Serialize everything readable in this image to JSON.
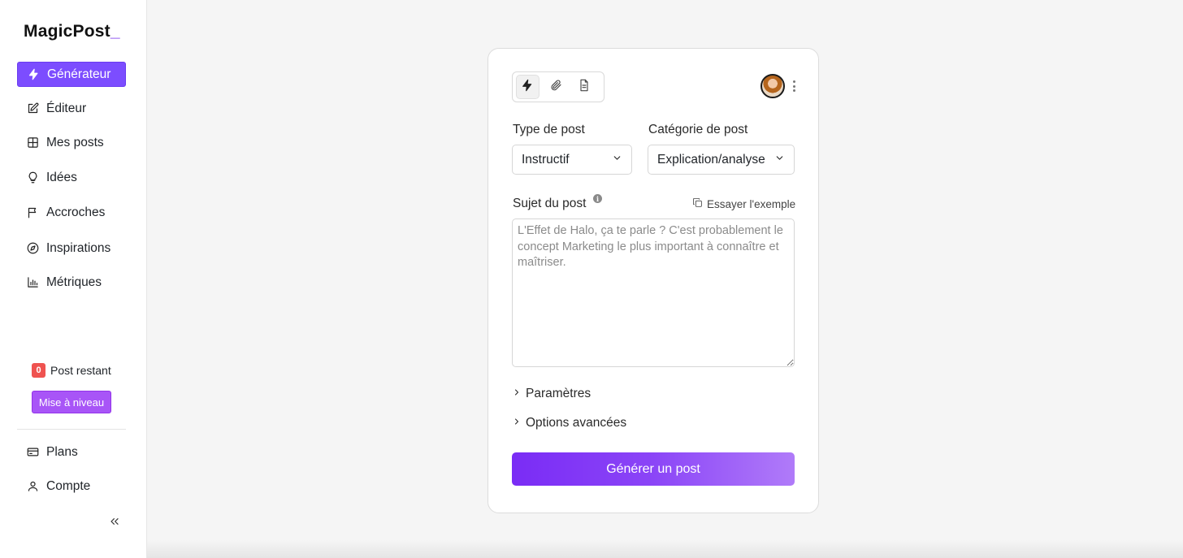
{
  "app": {
    "logo": "MagicPost",
    "logo_cursor": "_"
  },
  "sidebar": {
    "items": [
      {
        "label": "Générateur",
        "icon": "lightning-icon",
        "active": true
      },
      {
        "label": "Éditeur",
        "icon": "edit-icon"
      },
      {
        "label": "Mes posts",
        "icon": "grid-icon"
      },
      {
        "label": "Idées",
        "icon": "lightbulb-icon"
      },
      {
        "label": "Accroches",
        "icon": "flag-icon"
      },
      {
        "label": "Inspirations",
        "icon": "compass-icon"
      },
      {
        "label": "Métriques",
        "icon": "bar-chart-icon"
      }
    ],
    "quota_count": "0",
    "quota_label": "Post restant",
    "upgrade_label": "Mise à niveau",
    "bottom_items": [
      {
        "label": "Plans",
        "icon": "credit-card-icon"
      },
      {
        "label": "Compte",
        "icon": "user-icon"
      }
    ],
    "collapse_icon": "chevrons-left-icon"
  },
  "form": {
    "modes": [
      "lightning-icon",
      "paperclip-icon",
      "document-icon"
    ],
    "active_mode": 0,
    "post_type": {
      "label": "Type de post",
      "value": "Instructif"
    },
    "post_category": {
      "label": "Catégorie de post",
      "value": "Explication/analyse"
    },
    "subject": {
      "label": "Sujet du post",
      "info": "i",
      "example_link": "Essayer l'exemple",
      "placeholder": "L'Effet de Halo, ça te parle ? C'est probablement le concept Marketing le plus important à connaître et maîtriser.",
      "value": ""
    },
    "accordions": [
      "Paramètres",
      "Options avancées"
    ],
    "submit_label": "Générer un post"
  },
  "colors": {
    "accent": "#7c4dff",
    "upgrade": "#a855f7",
    "badge": "#ef5350",
    "button_gradient_start": "#7a2cf5",
    "button_gradient_end": "#b07bf9"
  }
}
